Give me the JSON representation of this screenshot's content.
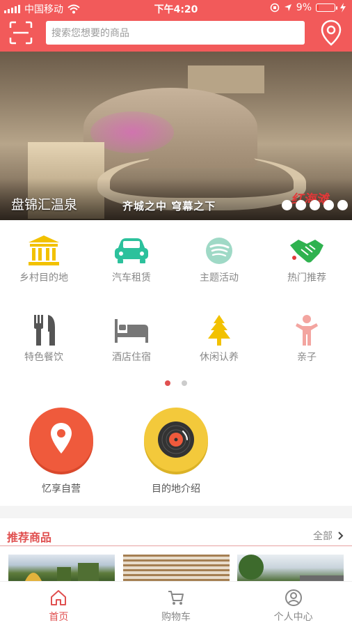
{
  "status": {
    "carrier": "中国移动",
    "time": "下午4:20",
    "battery_percent": "9%",
    "battery_level": 0.09
  },
  "search": {
    "placeholder": "搜索您想要的商品"
  },
  "banner": {
    "caption": "盘锦汇温泉",
    "slogan": "齐城之中 穹幕之下",
    "brand": "红海滩",
    "slide_count": 5
  },
  "categories": [
    {
      "label": "乡村目的地",
      "icon": "rural-building-icon",
      "color": "#f2c100"
    },
    {
      "label": "汽车租赁",
      "icon": "car-icon",
      "color": "#2cc19c"
    },
    {
      "label": "主题活动",
      "icon": "spotify-like-icon",
      "color": "#9fd9c6"
    },
    {
      "label": "热门推荐",
      "icon": "handshake-icon",
      "color": "#2fb24f"
    },
    {
      "label": "特色餐饮",
      "icon": "fork-knife-icon",
      "color": "#555555"
    },
    {
      "label": "酒店住宿",
      "icon": "bed-icon",
      "color": "#777777"
    },
    {
      "label": "休闲认养",
      "icon": "tree-icon",
      "color": "#f2c100"
    },
    {
      "label": "亲子",
      "icon": "child-icon",
      "color": "#f3a5a0"
    }
  ],
  "pager": {
    "active_color": "#e05050",
    "inactive_color": "#cccccc"
  },
  "features": [
    {
      "label": "忆享自营",
      "icon": "location-pin-icon",
      "color": "#ef5a3c"
    },
    {
      "label": "目的地介绍",
      "icon": "vinyl-record-icon",
      "color": "#f3c93b"
    }
  ],
  "recommend": {
    "title": "推荐商品",
    "more": "全部"
  },
  "tabs": [
    {
      "label": "首页",
      "icon": "home-icon"
    },
    {
      "label": "购物车",
      "icon": "cart-icon"
    },
    {
      "label": "个人中心",
      "icon": "user-icon"
    }
  ],
  "colors": {
    "brand": "#f25a5a",
    "accent_text": "#e05050"
  }
}
